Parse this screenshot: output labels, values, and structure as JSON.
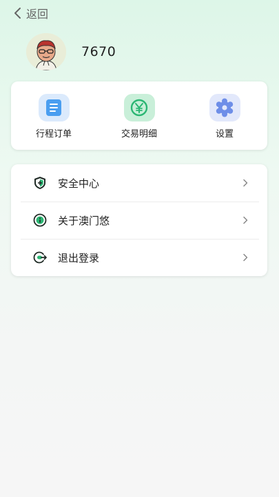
{
  "header": {
    "back_label": "返回"
  },
  "profile": {
    "username": "7670"
  },
  "shortcuts": [
    {
      "label": "行程订单",
      "icon": "document-icon",
      "color": "#4a9ef0",
      "bg": "#dbeafc"
    },
    {
      "label": "交易明细",
      "icon": "yen-icon",
      "color": "#2bb673",
      "bg": "#c9efd9"
    },
    {
      "label": "设置",
      "icon": "gear-icon",
      "color": "#6e8ee8",
      "bg": "#e2e8fb"
    }
  ],
  "menu": [
    {
      "label": "安全中心",
      "icon": "shield-plus-icon"
    },
    {
      "label": "关于澳门悠",
      "icon": "info-icon"
    },
    {
      "label": "退出登录",
      "icon": "logout-icon"
    }
  ],
  "colors": {
    "accent": "#2bb673",
    "icon_dark": "#1f2a25"
  }
}
